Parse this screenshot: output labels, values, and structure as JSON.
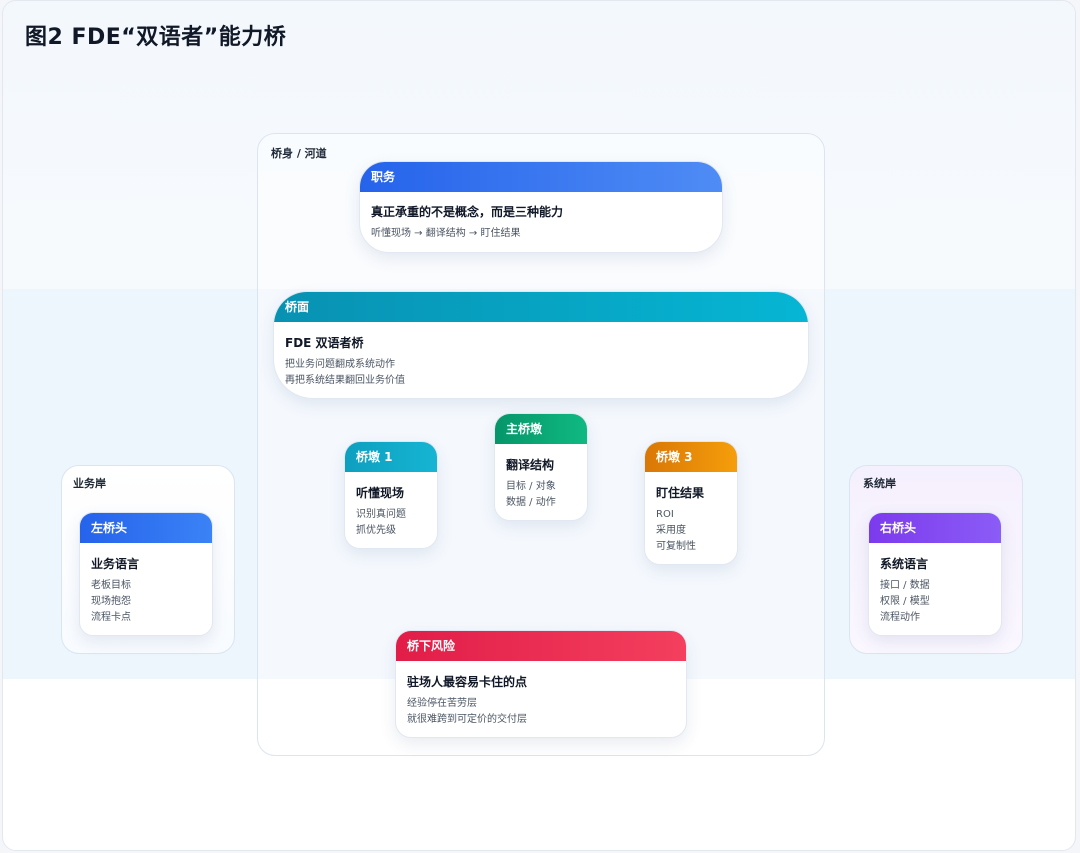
{
  "title": "图2 FDE“双语者”能力桥",
  "river": {
    "label": "桥身 / 河道"
  },
  "shores": {
    "left": "业务岸",
    "right": "系统岸"
  },
  "cards": {
    "zhuwu": {
      "header": "职务",
      "title": "真正承重的不是概念，而是三种能力",
      "lines": [
        "听懂现场 → 翻译结构 → 盯住结果"
      ]
    },
    "qiaomian": {
      "header": "桥面",
      "title": "FDE 双语者桥",
      "lines": [
        "把业务问题翻成系统动作",
        "再把系统结果翻回业务价值"
      ]
    },
    "pier1": {
      "header": "桥墩 1",
      "title": "听懂现场",
      "lines": [
        "识别真问题",
        "抓优先级"
      ]
    },
    "main_pier": {
      "header": "主桥墩",
      "title": "翻译结构",
      "lines": [
        "目标 / 对象",
        "数据 / 动作"
      ]
    },
    "pier3": {
      "header": "桥墩 3",
      "title": "盯住结果",
      "lines": [
        "ROI",
        "采用度",
        "可复制性"
      ]
    },
    "left_head": {
      "header": "左桥头",
      "title": "业务语言",
      "lines": [
        "老板目标",
        "现场抱怨",
        "流程卡点"
      ]
    },
    "right_head": {
      "header": "右桥头",
      "title": "系统语言",
      "lines": [
        "接口 / 数据",
        "权限 / 模型",
        "流程动作"
      ]
    },
    "risk": {
      "header": "桥下风险",
      "title": "驻场人最容易卡住的点",
      "lines": [
        "经验停在苦劳层",
        "就很难跨到可定价的交付层"
      ]
    }
  },
  "colors": {
    "blue": "#2563eb",
    "teal": "#0891b2",
    "green": "#059669",
    "orange": "#d97706",
    "red": "#e11d48",
    "purple": "#7c3aed",
    "band": "#edf5fd"
  }
}
